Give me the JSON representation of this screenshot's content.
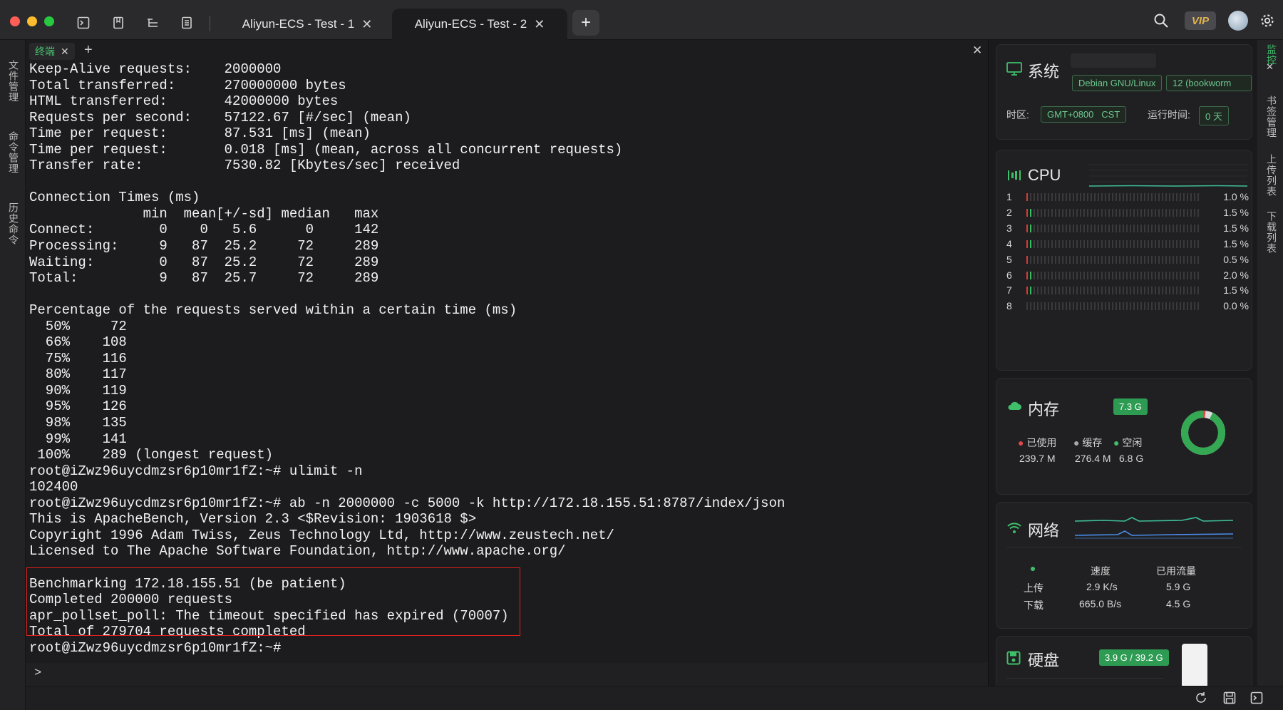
{
  "titlebar": {
    "tabs": [
      {
        "label": "Aliyun-ECS - Test - 1"
      },
      {
        "label": "Aliyun-ECS - Test - 2"
      }
    ],
    "vip_label": "VIP"
  },
  "leftbar": {
    "items": [
      "文件管理",
      "命令管理",
      "历史命令"
    ]
  },
  "rightbar": {
    "items": [
      "监控",
      "书签管理",
      "上传列表",
      "下载列表"
    ]
  },
  "terminal": {
    "tab_label": "终端",
    "lines": [
      "Keep-Alive requests:    2000000",
      "Total transferred:      270000000 bytes",
      "HTML transferred:       42000000 bytes",
      "Requests per second:    57122.67 [#/sec] (mean)",
      "Time per request:       87.531 [ms] (mean)",
      "Time per request:       0.018 [ms] (mean, across all concurrent requests)",
      "Transfer rate:          7530.82 [Kbytes/sec] received",
      "",
      "Connection Times (ms)",
      "              min  mean[+/-sd] median   max",
      "Connect:        0    0   5.6      0     142",
      "Processing:     9   87  25.2     72     289",
      "Waiting:        0   87  25.2     72     289",
      "Total:          9   87  25.7     72     289",
      "",
      "Percentage of the requests served within a certain time (ms)",
      "  50%     72",
      "  66%    108",
      "  75%    116",
      "  80%    117",
      "  90%    119",
      "  95%    126",
      "  98%    135",
      "  99%    141",
      " 100%    289 (longest request)",
      "root@iZwz96uycdmzsr6p10mr1fZ:~# ulimit -n",
      "102400",
      "root@iZwz96uycdmzsr6p10mr1fZ:~# ab -n 2000000 -c 5000 -k http://172.18.155.51:8787/index/json",
      "This is ApacheBench, Version 2.3 <$Revision: 1903618 $>",
      "Copyright 1996 Adam Twiss, Zeus Technology Ltd, http://www.zeustech.net/",
      "Licensed to The Apache Software Foundation, http://www.apache.org/",
      "",
      "Benchmarking 172.18.155.51 (be patient)",
      "Completed 200000 requests",
      "apr_pollset_poll: The timeout specified has expired (70007)",
      "Total of 279704 requests completed",
      "root@iZwz96uycdmzsr6p10mr1fZ:~#"
    ],
    "input_prompt": ">"
  },
  "panel": {
    "system": {
      "title": "系统",
      "os_tag": "Debian GNU/Linux",
      "version_tag": "12 (bookworm",
      "tz_label": "时区:",
      "tz_value": "GMT+0800   CST",
      "uptime_label": "运行时间:",
      "uptime_value": "0 天"
    },
    "cpu": {
      "title": "CPU",
      "cores": [
        {
          "idx": "1",
          "pct": "1.0 %",
          "red": 1,
          "green": 0
        },
        {
          "idx": "2",
          "pct": "1.5 %",
          "red": 1,
          "green": 1
        },
        {
          "idx": "3",
          "pct": "1.5 %",
          "red": 1,
          "green": 1
        },
        {
          "idx": "4",
          "pct": "1.5 %",
          "red": 1,
          "green": 1
        },
        {
          "idx": "5",
          "pct": "0.5 %",
          "red": 1,
          "green": 0
        },
        {
          "idx": "6",
          "pct": "2.0 %",
          "red": 1,
          "green": 1
        },
        {
          "idx": "7",
          "pct": "1.5 %",
          "red": 1,
          "green": 1
        },
        {
          "idx": "8",
          "pct": "0.0 %",
          "red": 0,
          "green": 0
        }
      ]
    },
    "memory": {
      "title": "内存",
      "total_tag": "7.3 G",
      "used_label": "已使用",
      "cache_label": "缓存",
      "free_label": "空闲",
      "used_value": "239.7 M",
      "cache_value": "276.4 M",
      "free_value": "6.8 G",
      "free_fraction": 0.93
    },
    "network": {
      "title": "网络",
      "speed_header": "速度",
      "used_header": "已用流量",
      "upload_label": "上传",
      "download_label": "下载",
      "upload_speed": "2.9 K/s",
      "download_speed": "665.0 B/s",
      "upload_used": "5.9 G",
      "download_used": "4.5 G"
    },
    "disk": {
      "title": "硬盘",
      "usage_tag": "3.9 G / 39.2 G"
    }
  },
  "colors": {
    "accent_green": "#2e9b53",
    "highlight_red": "#e02020"
  }
}
